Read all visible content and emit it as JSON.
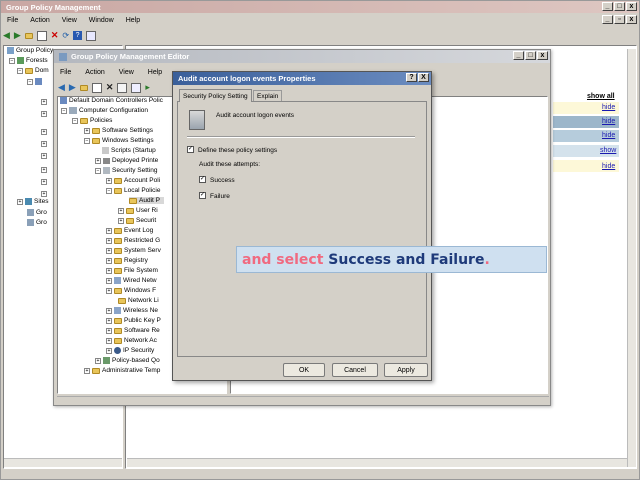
{
  "outer_window": {
    "title": "Group Policy Management",
    "menu": [
      "File",
      "Action",
      "View",
      "Window",
      "Help"
    ],
    "tree": [
      "Group Policy",
      "Forests",
      "Dom",
      "Sites",
      "Gro",
      "Gro"
    ],
    "right_links": [
      "show all",
      "hide",
      "hide",
      "hide",
      "show",
      "hide"
    ]
  },
  "editor_window": {
    "title": "Group Policy Management Editor",
    "menu": [
      "File",
      "Action",
      "View",
      "Help"
    ],
    "tree": [
      "Default Domain Controllers Polic",
      "Computer Configuration",
      "Policies",
      "Software Settings",
      "Windows Settings",
      "Scripts (Startup",
      "Deployed Printe",
      "Security Setting",
      "Account Poli",
      "Local Policie",
      "Audit P",
      "User Ri",
      "Securit",
      "Event Log",
      "Restricted G",
      "System Serv",
      "Registry",
      "File System",
      "Wired Netw",
      "Windows F",
      "Network Li",
      "Wireless Ne",
      "Public Key P",
      "Software Re",
      "Network Ac",
      "IP Security",
      "Policy-based Qo",
      "Administrative Temp"
    ]
  },
  "dialog": {
    "title": "Audit account logon events Properties",
    "help": "?",
    "close": "X",
    "tabs": [
      "Security Policy Setting",
      "Explain"
    ],
    "policy_name": "Audit account logon events",
    "define_label": "Define these policy settings",
    "audit_label": "Audit these attempts:",
    "success_label": "Success",
    "failure_label": "Failure",
    "ok": "OK",
    "cancel": "Cancel",
    "apply": "Apply"
  },
  "caption": {
    "part1": "and select ",
    "part2": "Success and Failure",
    "part3": "."
  }
}
